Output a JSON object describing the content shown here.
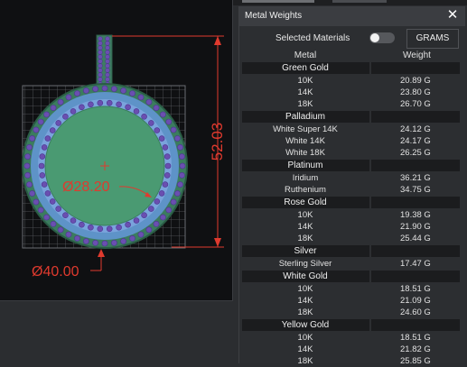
{
  "viewport": {
    "height_dimension": "52.03",
    "inner_diameter": "Ø28.20",
    "outer_diameter": "Ø40.00",
    "dimension_color": "#e03a2e"
  },
  "panel": {
    "title": "Metal Weights",
    "close_glyph": "✕",
    "selected_materials_label": "Selected Materials",
    "selected_materials_on": false,
    "units_button": "GRAMS",
    "columns": {
      "metal": "Metal",
      "weight": "Weight"
    },
    "groups": [
      {
        "name": "Green Gold",
        "rows": [
          {
            "metal": "10K",
            "weight": "20.89 G"
          },
          {
            "metal": "14K",
            "weight": "23.80 G"
          },
          {
            "metal": "18K",
            "weight": "26.70 G"
          }
        ]
      },
      {
        "name": "Palladium",
        "rows": [
          {
            "metal": "White Super 14K",
            "weight": "24.12 G"
          },
          {
            "metal": "White 14K",
            "weight": "24.17 G"
          },
          {
            "metal": "White 18K",
            "weight": "26.25 G"
          }
        ]
      },
      {
        "name": "Platinum",
        "rows": [
          {
            "metal": "Iridium",
            "weight": "36.21 G"
          },
          {
            "metal": "Ruthenium",
            "weight": "34.75 G"
          }
        ]
      },
      {
        "name": "Rose Gold",
        "rows": [
          {
            "metal": "10K",
            "weight": "19.38 G"
          },
          {
            "metal": "14K",
            "weight": "21.90 G"
          },
          {
            "metal": "18K",
            "weight": "25.44 G"
          }
        ]
      },
      {
        "name": "Silver",
        "rows": [
          {
            "metal": "Sterling Silver",
            "weight": "17.47 G"
          }
        ]
      },
      {
        "name": "White Gold",
        "rows": [
          {
            "metal": "10K",
            "weight": "18.51 G"
          },
          {
            "metal": "14K",
            "weight": "21.09 G"
          },
          {
            "metal": "18K",
            "weight": "24.60 G"
          }
        ]
      },
      {
        "name": "Yellow Gold",
        "rows": [
          {
            "metal": "10K",
            "weight": "18.51 G"
          },
          {
            "metal": "14K",
            "weight": "21.82 G"
          },
          {
            "metal": "18K",
            "weight": "25.85 G"
          }
        ]
      }
    ]
  }
}
